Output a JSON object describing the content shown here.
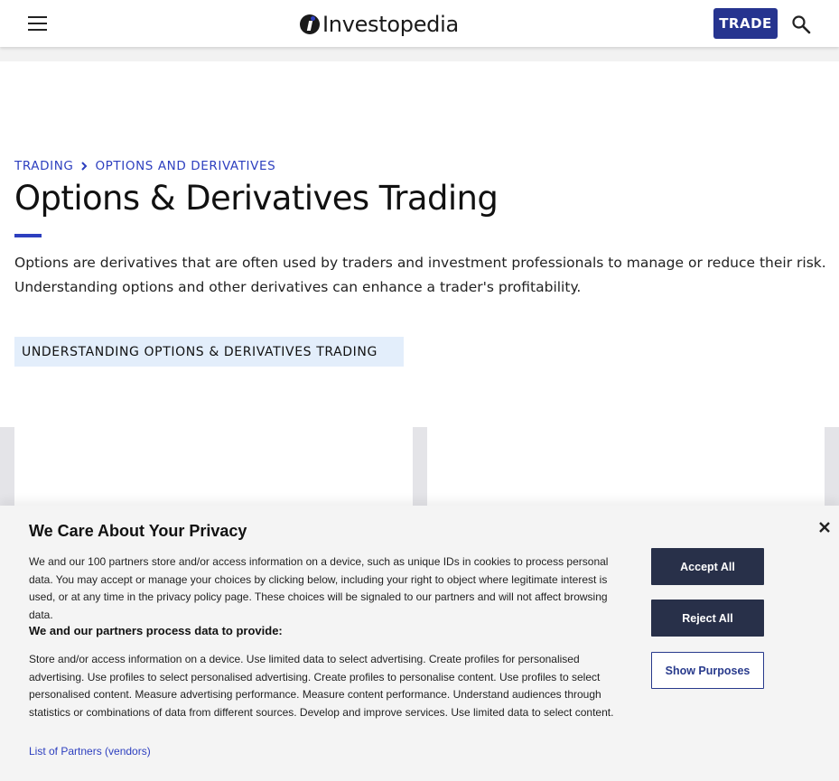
{
  "header": {
    "logo_text": "Investopedia",
    "trade_label": "TRADE",
    "menu_icon": "hamburger-menu-icon",
    "search_icon": "search-icon",
    "brand_color": "#26348f"
  },
  "breadcrumb": {
    "items": [
      "TRADING",
      "OPTIONS AND DERIVATIVES"
    ],
    "separator_icon": "chevron-right-icon"
  },
  "page": {
    "title": "Options & Derivatives Trading",
    "intro": "Options are derivatives that are often used by traders and investment professionals to manage or reduce their risk. Understanding options and other derivatives can enhance a trader's profitability.",
    "section_tag": "UNDERSTANDING OPTIONS & DERIVATIVES TRADING",
    "accent_color": "#2d3fbf"
  },
  "privacy": {
    "title": "We Care About Your Privacy",
    "body": "We and our 100 partners store and/or access information on a device, such as unique IDs in cookies to process personal data. You may accept or manage your choices by clicking below, including your right to object where legitimate interest is used, or at any time in the privacy policy page. These choices will be signaled to our partners and will not affect browsing data.",
    "subtitle": "We and our partners process data to provide:",
    "purposes": "Store and/or access information on a device. Use limited data to select advertising. Create profiles for personalised advertising. Use profiles to select personalised advertising. Create profiles to personalise content. Use profiles to select personalised content. Measure advertising performance. Measure content performance. Understand audiences through statistics or combinations of data from different sources. Develop and improve services. Use limited data to select content.",
    "partners_link": "List of Partners (vendors)",
    "accept_label": "Accept All",
    "reject_label": "Reject All",
    "show_purposes_label": "Show Purposes",
    "close_icon": "close-icon"
  }
}
